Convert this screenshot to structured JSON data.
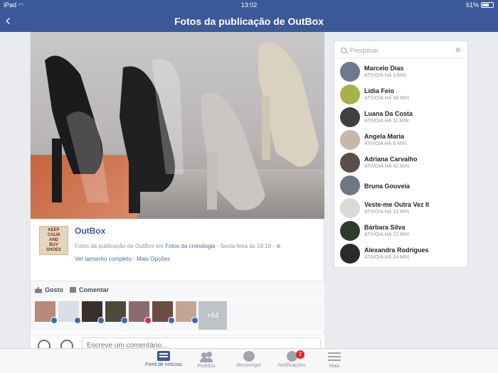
{
  "status_bar": {
    "device": "iPad",
    "time": "13:02",
    "battery": "61%"
  },
  "nav": {
    "title": "Fotos da publicação de OutBox",
    "back_icon": "chevron-left-icon"
  },
  "post": {
    "logo_text": [
      "KEEP",
      "CALM",
      "AND",
      "BUY",
      "SHOES"
    ],
    "page_name": "OutBox",
    "meta_prefix": "Fotos da publicação de OutBox",
    "meta_in": " em ",
    "meta_album": "Fotos da cronologia",
    "meta_date": " · Sexta-feira às 14:18 · ",
    "link_full_size": "Ver tamanho completo",
    "link_separator": " · ",
    "link_more_options": "Mais Opções",
    "like_label": "Gosto",
    "comment_label": "Comentar",
    "more_likers": "+64",
    "comment_placeholder": "Escreve um comentário..."
  },
  "chat": {
    "search_placeholder": "Pesquisar",
    "contacts": [
      {
        "name": "Marcelo Dias",
        "status": "ATIVO/A HÁ 3 MIN",
        "color": "#6b7a8f"
      },
      {
        "name": "Lídia Feio",
        "status": "ATIVO/A HÁ 34 MIN",
        "color": "#a9b04a"
      },
      {
        "name": "Luana Da Costa",
        "status": "ATIVO/A HÁ 11 MIN",
        "color": "#3f3f3f"
      },
      {
        "name": "Angela Maria",
        "status": "ATIVO/A HÁ 6 MIN",
        "color": "#c7b7a7"
      },
      {
        "name": "Adriana Carvalho",
        "status": "ATIVO/A HÁ 42 MIN",
        "color": "#5a4d4a"
      },
      {
        "name": "Bruna Gouveia",
        "status": "",
        "color": "#6f7687"
      },
      {
        "name": "Veste-me Outra Vez II",
        "status": "ATIVO/A HÁ 13 MIN",
        "color": "#d9d9d9"
      },
      {
        "name": "Bárbara Silva",
        "status": "ATIVO/A HÁ 22 MIN",
        "color": "#2f3b2c"
      },
      {
        "name": "Alexandra Rodrigues",
        "status": "ATIVO/A HÁ 24 MIN",
        "color": "#2a2a2a"
      }
    ]
  },
  "tabs": [
    {
      "label": "Feed de notícias",
      "icon": "news-feed-icon",
      "active": true
    },
    {
      "label": "Pedidos",
      "icon": "friend-requests-icon",
      "active": false
    },
    {
      "label": "Messenger",
      "icon": "messenger-icon",
      "active": false
    },
    {
      "label": "Notificações",
      "icon": "globe-icon",
      "active": false,
      "badge": "2"
    },
    {
      "label": "Mais",
      "icon": "menu-icon",
      "active": false
    }
  ]
}
